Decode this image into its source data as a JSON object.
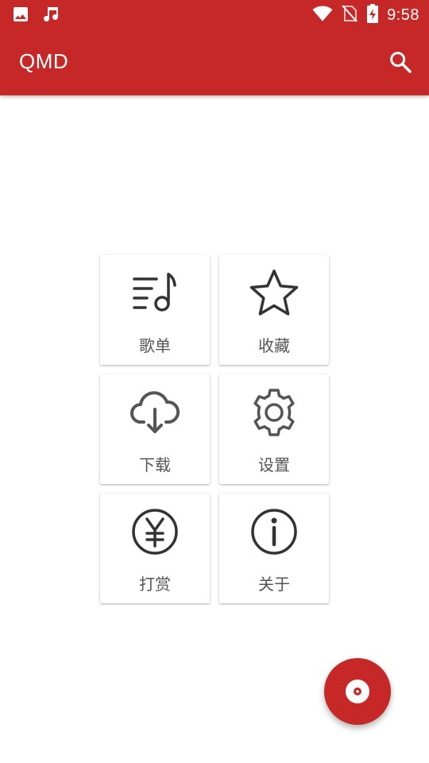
{
  "status_bar": {
    "time": "9:58",
    "left_icons": [
      "image-icon",
      "music-note-icon"
    ],
    "right_icons": [
      "wifi-icon",
      "no-sim-icon",
      "battery-charging-icon"
    ]
  },
  "app_bar": {
    "title": "QMD",
    "action_icon": "search-icon",
    "color": "#c62828"
  },
  "menu": {
    "items": [
      {
        "label": "歌单",
        "icon": "playlist-icon"
      },
      {
        "label": "收藏",
        "icon": "star-icon"
      },
      {
        "label": "下载",
        "icon": "cloud-download-icon"
      },
      {
        "label": "设置",
        "icon": "gear-icon"
      },
      {
        "label": "打赏",
        "icon": "yen-icon"
      },
      {
        "label": "关于",
        "icon": "info-icon"
      }
    ]
  },
  "fab": {
    "icon": "disc-icon",
    "color": "#c62828"
  }
}
